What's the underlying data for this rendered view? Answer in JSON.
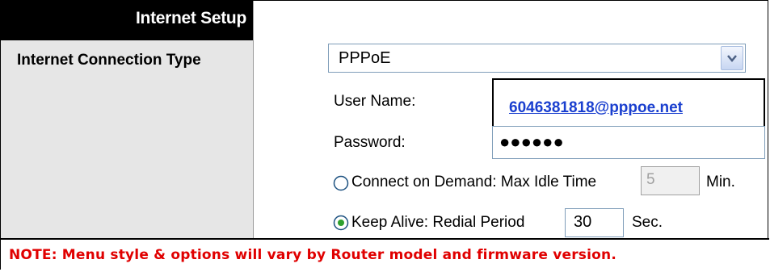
{
  "section": {
    "title": "Internet Setup"
  },
  "connection": {
    "label": "Internet Connection Type",
    "selected": "PPPoE"
  },
  "fields": {
    "username_label": "User Name:",
    "username_value": "6046381818@pppoe.net",
    "password_label": "Password:",
    "password_value": "●●●●●●"
  },
  "connect_on_demand": {
    "label": "Connect on Demand: Max Idle Time",
    "value": "5",
    "unit": "Min.",
    "selected": false
  },
  "keep_alive": {
    "label": "Keep Alive: Redial Period",
    "value": "30",
    "unit": "Sec.",
    "selected": true
  },
  "note": "NOTE:  Menu style & options will vary by Router model and firmware version.",
  "colors": {
    "note": "#e00000",
    "link": "#1a3fcf",
    "header_bg": "#000000",
    "panel_bg": "#e6e6e6"
  }
}
